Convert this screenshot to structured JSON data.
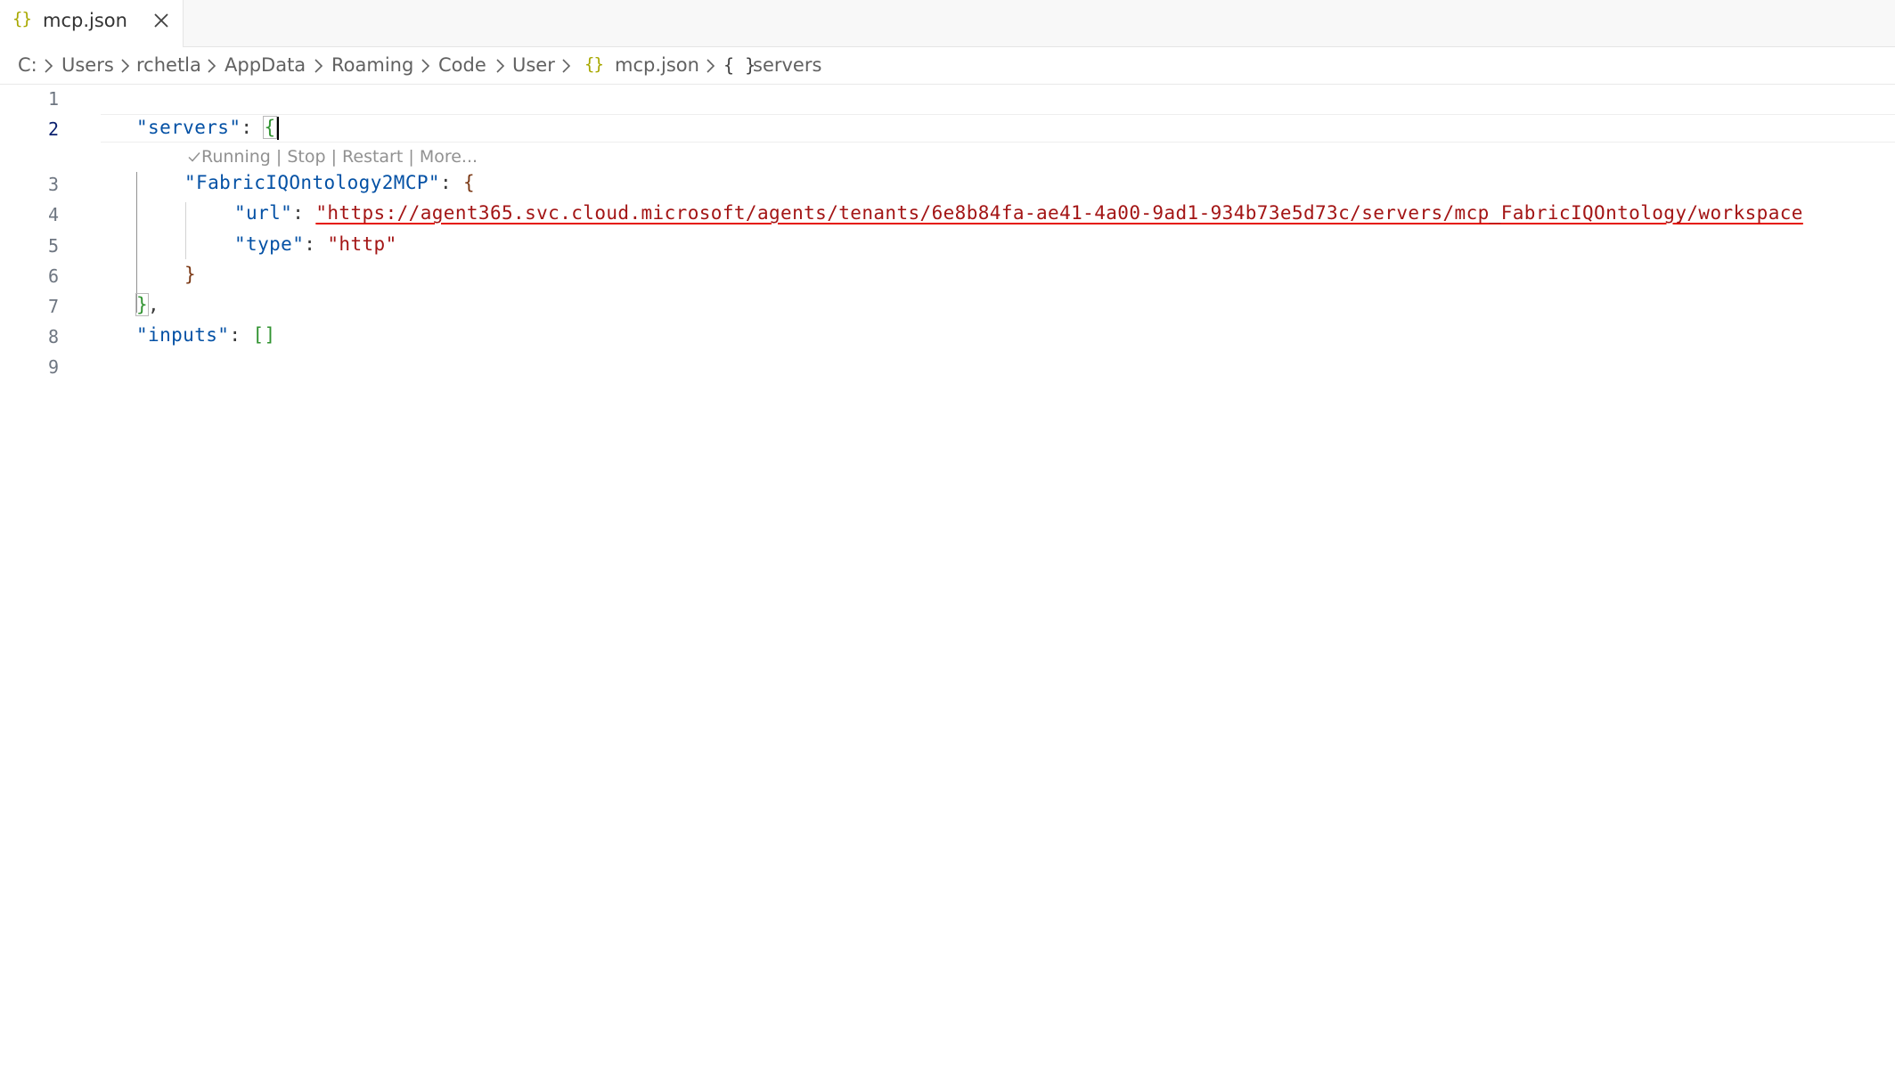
{
  "tab": {
    "icon": "json-braces-icon",
    "label": "mcp.json"
  },
  "breadcrumb": {
    "items": [
      "C:",
      "Users",
      "rchetla",
      "AppData",
      "Roaming",
      "Code",
      "User"
    ],
    "file": "mcp.json",
    "symbol": "servers"
  },
  "editor": {
    "line_numbers": [
      "1",
      "2",
      "3",
      "4",
      "5",
      "6",
      "7",
      "8",
      "9"
    ],
    "active_line": "2",
    "codelens": {
      "status": "Running",
      "stop": "Stop",
      "restart": "Restart",
      "more": "More..."
    },
    "code": {
      "servers_key": "\"servers\"",
      "server_name_key": "\"FabricIQOntology2MCP\"",
      "url_key": "\"url\"",
      "url_value": "\"https://agent365.svc.cloud.microsoft/agents/tenants/6e8b84fa-ae41-4a00-9ad1-934b73e5d73c/servers/mcp_FabricIQOntology/workspace",
      "type_key": "\"type\"",
      "type_value": "\"http\"",
      "inputs_key": "\"inputs\""
    }
  },
  "colors": {
    "json_key": "#0451a5",
    "json_string": "#a31515",
    "bracket_level1": "#319331",
    "bracket_level2": "#7b3814",
    "error_underline": "#e51400",
    "json_icon": "#a8a800"
  }
}
